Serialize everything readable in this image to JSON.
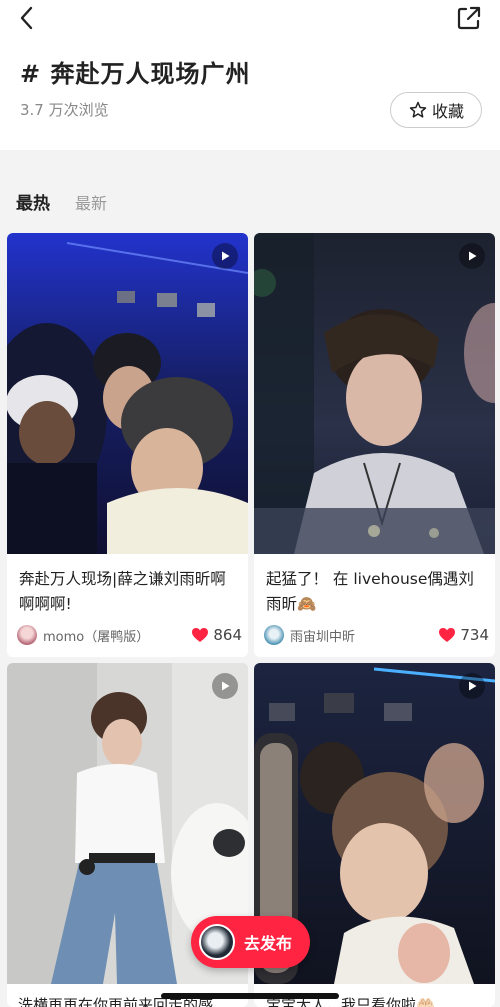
{
  "header": {
    "topic_title": "# 奔赴万人现场广州",
    "views": "3.7 万次浏览",
    "collect_label": "收藏"
  },
  "tabs": {
    "hot": "最热",
    "latest": "最新"
  },
  "feed": [
    {
      "title": "奔赴万人现场|薛之谦刘雨昕啊啊啊啊!",
      "author": "momo（屠鸭版）",
      "likes": "864",
      "type": "video"
    },
    {
      "title": "起猛了！ 在 livehouse偶遇刘雨昕🙈",
      "author": "雨宙圳中昕",
      "likes": "734",
      "type": "video"
    },
    {
      "title": "洗横再再在你再前来回走的感",
      "type": "video"
    },
    {
      "title": "宝宝大人，我只看你啦🤲🏻",
      "type": "video"
    }
  ],
  "publish": {
    "label": "去发布"
  },
  "colors": {
    "accent": "#ff2442",
    "like": "#ff2442"
  },
  "icons": {
    "back": "back-icon",
    "share": "share-icon",
    "collect": "star-icon",
    "play": "play-icon",
    "like": "heart-icon"
  }
}
